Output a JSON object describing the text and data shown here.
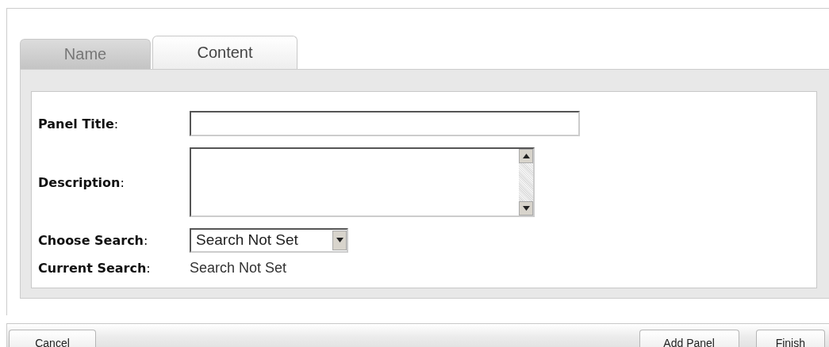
{
  "tabs": [
    {
      "label": "Name",
      "selected": false
    },
    {
      "label": "Content",
      "selected": true
    }
  ],
  "form": {
    "fields": [
      {
        "kind": "text",
        "label": "**Panel Title**:"
      },
      {
        "kind": "textarea",
        "label": "**Description**:"
      },
      {
        "kind": "select",
        "label": "**Choose Search**:",
        "value": "Search Not Set"
      },
      {
        "kind": "readout",
        "label": "**Current Search**:",
        "value": "Search Not Set"
      }
    ]
  },
  "footer": {
    "left_buttons": [
      "Cancel"
    ],
    "right_buttons": [
      "Add Panel",
      "Finish"
    ]
  }
}
